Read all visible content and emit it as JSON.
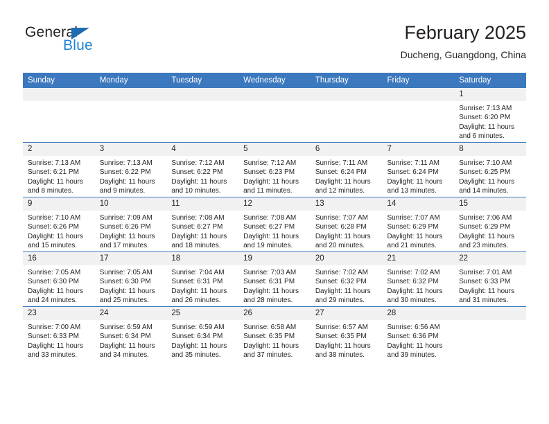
{
  "brand": {
    "name_part1": "General",
    "name_part2": "Blue",
    "color_dark": "#231f20",
    "color_blue": "#1f84d6",
    "triangle_color": "#1f6cb0"
  },
  "header": {
    "title": "February 2025",
    "subtitle": "Ducheng, Guangdong, China"
  },
  "theme": {
    "header_bg": "#3b78be",
    "daynum_bg": "#f1f1f1",
    "cell_bg": "#ffffff",
    "text": "#231f20"
  },
  "weekdays": [
    "Sunday",
    "Monday",
    "Tuesday",
    "Wednesday",
    "Thursday",
    "Friday",
    "Saturday"
  ],
  "weeks": [
    [
      {
        "day": "",
        "empty": true
      },
      {
        "day": "",
        "empty": true
      },
      {
        "day": "",
        "empty": true
      },
      {
        "day": "",
        "empty": true
      },
      {
        "day": "",
        "empty": true
      },
      {
        "day": "",
        "empty": true
      },
      {
        "day": "1",
        "sunrise": "Sunrise: 7:13 AM",
        "sunset": "Sunset: 6:20 PM",
        "daylight": "Daylight: 11 hours and 6 minutes."
      }
    ],
    [
      {
        "day": "2",
        "sunrise": "Sunrise: 7:13 AM",
        "sunset": "Sunset: 6:21 PM",
        "daylight": "Daylight: 11 hours and 8 minutes."
      },
      {
        "day": "3",
        "sunrise": "Sunrise: 7:13 AM",
        "sunset": "Sunset: 6:22 PM",
        "daylight": "Daylight: 11 hours and 9 minutes."
      },
      {
        "day": "4",
        "sunrise": "Sunrise: 7:12 AM",
        "sunset": "Sunset: 6:22 PM",
        "daylight": "Daylight: 11 hours and 10 minutes."
      },
      {
        "day": "5",
        "sunrise": "Sunrise: 7:12 AM",
        "sunset": "Sunset: 6:23 PM",
        "daylight": "Daylight: 11 hours and 11 minutes."
      },
      {
        "day": "6",
        "sunrise": "Sunrise: 7:11 AM",
        "sunset": "Sunset: 6:24 PM",
        "daylight": "Daylight: 11 hours and 12 minutes."
      },
      {
        "day": "7",
        "sunrise": "Sunrise: 7:11 AM",
        "sunset": "Sunset: 6:24 PM",
        "daylight": "Daylight: 11 hours and 13 minutes."
      },
      {
        "day": "8",
        "sunrise": "Sunrise: 7:10 AM",
        "sunset": "Sunset: 6:25 PM",
        "daylight": "Daylight: 11 hours and 14 minutes."
      }
    ],
    [
      {
        "day": "9",
        "sunrise": "Sunrise: 7:10 AM",
        "sunset": "Sunset: 6:26 PM",
        "daylight": "Daylight: 11 hours and 15 minutes."
      },
      {
        "day": "10",
        "sunrise": "Sunrise: 7:09 AM",
        "sunset": "Sunset: 6:26 PM",
        "daylight": "Daylight: 11 hours and 17 minutes."
      },
      {
        "day": "11",
        "sunrise": "Sunrise: 7:08 AM",
        "sunset": "Sunset: 6:27 PM",
        "daylight": "Daylight: 11 hours and 18 minutes."
      },
      {
        "day": "12",
        "sunrise": "Sunrise: 7:08 AM",
        "sunset": "Sunset: 6:27 PM",
        "daylight": "Daylight: 11 hours and 19 minutes."
      },
      {
        "day": "13",
        "sunrise": "Sunrise: 7:07 AM",
        "sunset": "Sunset: 6:28 PM",
        "daylight": "Daylight: 11 hours and 20 minutes."
      },
      {
        "day": "14",
        "sunrise": "Sunrise: 7:07 AM",
        "sunset": "Sunset: 6:29 PM",
        "daylight": "Daylight: 11 hours and 21 minutes."
      },
      {
        "day": "15",
        "sunrise": "Sunrise: 7:06 AM",
        "sunset": "Sunset: 6:29 PM",
        "daylight": "Daylight: 11 hours and 23 minutes."
      }
    ],
    [
      {
        "day": "16",
        "sunrise": "Sunrise: 7:05 AM",
        "sunset": "Sunset: 6:30 PM",
        "daylight": "Daylight: 11 hours and 24 minutes."
      },
      {
        "day": "17",
        "sunrise": "Sunrise: 7:05 AM",
        "sunset": "Sunset: 6:30 PM",
        "daylight": "Daylight: 11 hours and 25 minutes."
      },
      {
        "day": "18",
        "sunrise": "Sunrise: 7:04 AM",
        "sunset": "Sunset: 6:31 PM",
        "daylight": "Daylight: 11 hours and 26 minutes."
      },
      {
        "day": "19",
        "sunrise": "Sunrise: 7:03 AM",
        "sunset": "Sunset: 6:31 PM",
        "daylight": "Daylight: 11 hours and 28 minutes."
      },
      {
        "day": "20",
        "sunrise": "Sunrise: 7:02 AM",
        "sunset": "Sunset: 6:32 PM",
        "daylight": "Daylight: 11 hours and 29 minutes."
      },
      {
        "day": "21",
        "sunrise": "Sunrise: 7:02 AM",
        "sunset": "Sunset: 6:32 PM",
        "daylight": "Daylight: 11 hours and 30 minutes."
      },
      {
        "day": "22",
        "sunrise": "Sunrise: 7:01 AM",
        "sunset": "Sunset: 6:33 PM",
        "daylight": "Daylight: 11 hours and 31 minutes."
      }
    ],
    [
      {
        "day": "23",
        "sunrise": "Sunrise: 7:00 AM",
        "sunset": "Sunset: 6:33 PM",
        "daylight": "Daylight: 11 hours and 33 minutes."
      },
      {
        "day": "24",
        "sunrise": "Sunrise: 6:59 AM",
        "sunset": "Sunset: 6:34 PM",
        "daylight": "Daylight: 11 hours and 34 minutes."
      },
      {
        "day": "25",
        "sunrise": "Sunrise: 6:59 AM",
        "sunset": "Sunset: 6:34 PM",
        "daylight": "Daylight: 11 hours and 35 minutes."
      },
      {
        "day": "26",
        "sunrise": "Sunrise: 6:58 AM",
        "sunset": "Sunset: 6:35 PM",
        "daylight": "Daylight: 11 hours and 37 minutes."
      },
      {
        "day": "27",
        "sunrise": "Sunrise: 6:57 AM",
        "sunset": "Sunset: 6:35 PM",
        "daylight": "Daylight: 11 hours and 38 minutes."
      },
      {
        "day": "28",
        "sunrise": "Sunrise: 6:56 AM",
        "sunset": "Sunset: 6:36 PM",
        "daylight": "Daylight: 11 hours and 39 minutes."
      },
      {
        "day": "",
        "empty": true
      }
    ]
  ]
}
